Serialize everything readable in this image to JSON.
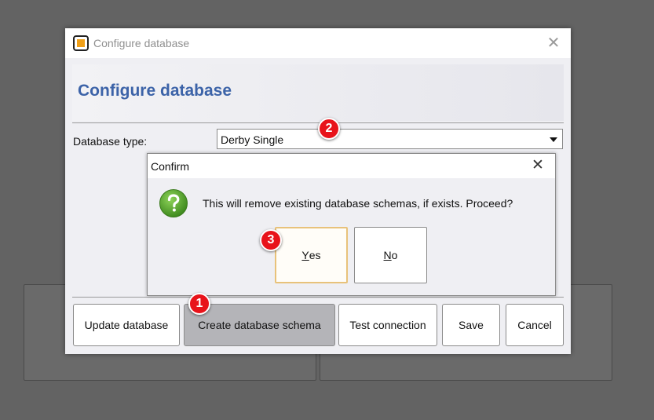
{
  "window": {
    "title": "Configure database",
    "heading": "Configure database",
    "close_glyph": "✕"
  },
  "form": {
    "database_type_label": "Database type:",
    "database_type_value": "Derby Single"
  },
  "buttons": {
    "update": "Update database",
    "create_schema": "Create database schema",
    "test": "Test connection",
    "save": "Save",
    "cancel": "Cancel"
  },
  "confirm": {
    "title": "Confirm",
    "message": "This will remove existing database schemas, if exists. Proceed?",
    "yes_mnemonic": "Y",
    "yes_rest": "es",
    "no_mnemonic": "N",
    "no_rest": "o",
    "close_glyph": "✕"
  },
  "markers": [
    "1",
    "2",
    "3"
  ],
  "colors": {
    "accent_heading": "#3c63a8",
    "marker_red": "#e8131a",
    "question_green": "#5aaa2e",
    "app_icon_orange": "#f0a018",
    "default_button_border": "#e8c27a"
  },
  "icons": {
    "app": "app-logo-icon",
    "question": "question-icon",
    "dropdown": "chevron-down-icon",
    "close": "close-icon"
  }
}
